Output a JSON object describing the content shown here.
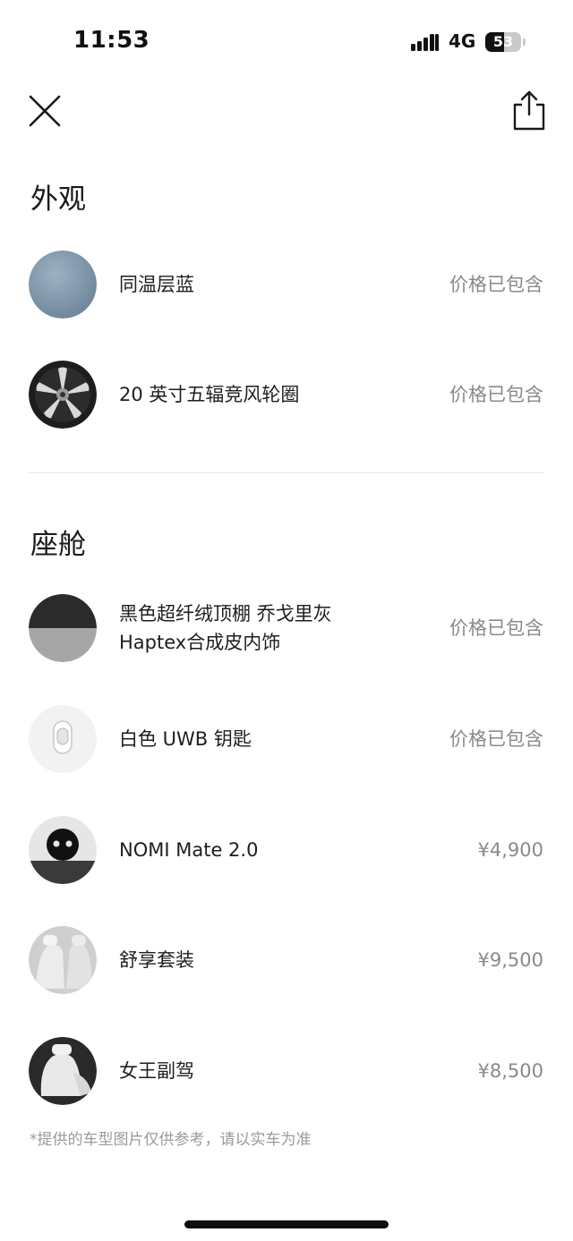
{
  "status_bar": {
    "time": "11:53",
    "network": "4G",
    "battery": "53",
    "battery_level": 0.53
  },
  "header": {
    "close_icon": "close-icon",
    "share_icon": "share-icon"
  },
  "sections": [
    {
      "title": "外观",
      "items": [
        {
          "name": "同温层蓝",
          "price": "价格已包含",
          "thumb": "blue-paint-swatch",
          "color": "#7f97ac"
        },
        {
          "name": "20 英寸五辐竞风轮圈",
          "price": "价格已包含",
          "thumb": "wheel-rim"
        }
      ]
    },
    {
      "title": "座舱",
      "items": [
        {
          "name_line1": "黑色超纤绒顶棚 乔戈里灰",
          "name_line2": "Haptex合成皮内饰",
          "price": "价格已包含",
          "thumb": "interior-swatch"
        },
        {
          "name": "白色 UWB 钥匙",
          "price": "价格已包含",
          "thumb": "uwb-key"
        },
        {
          "name": "NOMI Mate 2.0",
          "price": "¥4,900",
          "thumb": "nomi-robot"
        },
        {
          "name": "舒享套装",
          "price": "¥9,500",
          "thumb": "seat-package"
        },
        {
          "name": "女王副驾",
          "price": "¥8,500",
          "thumb": "queen-seat"
        }
      ]
    }
  ],
  "disclaimer": "*提供的车型图片仅供参考，请以实车为准"
}
